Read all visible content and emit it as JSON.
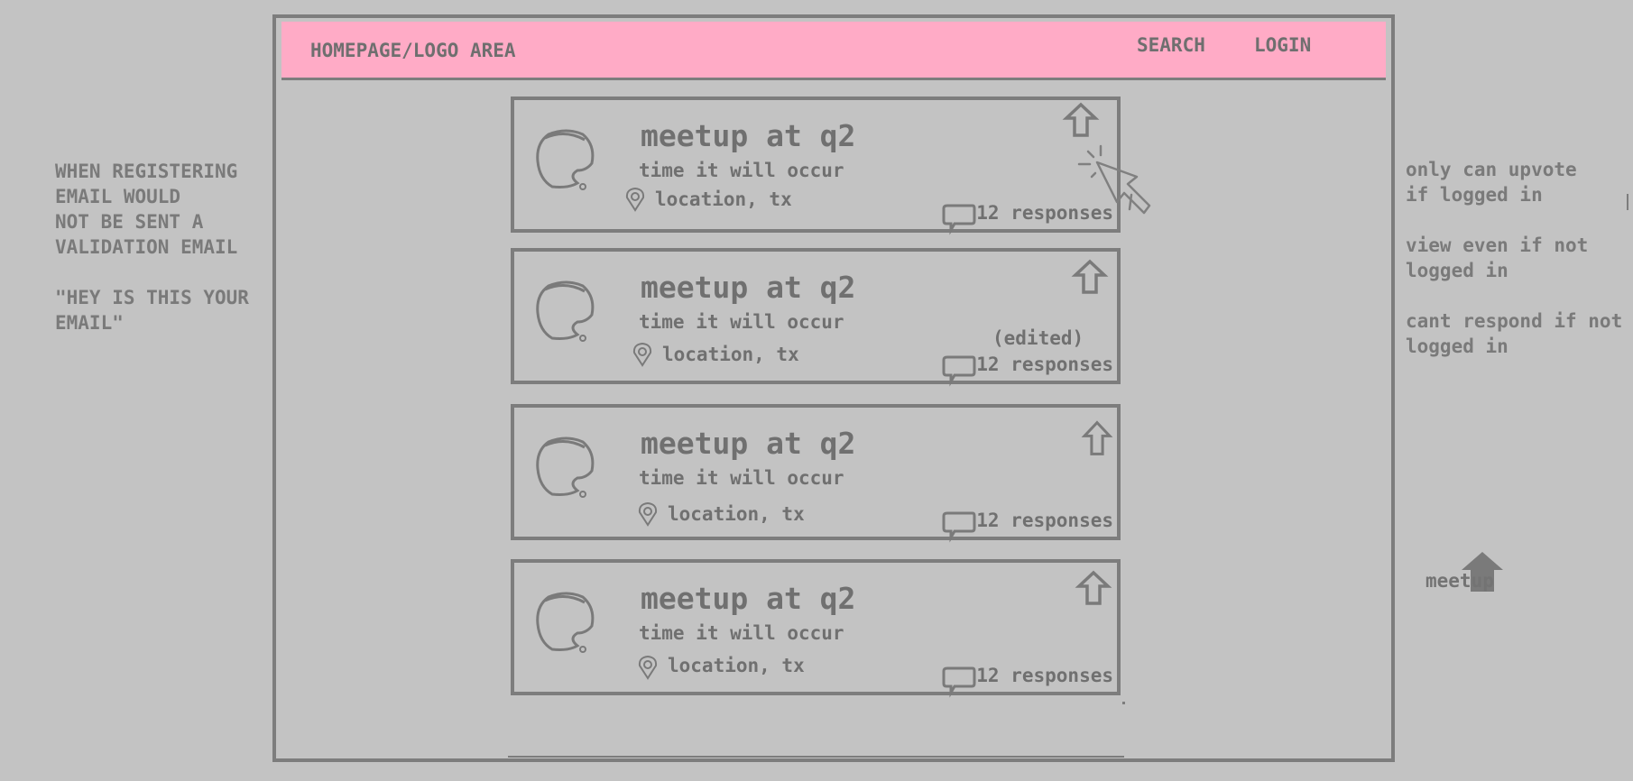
{
  "notes": {
    "left": "WHEN REGISTERING\nEMAIL WOULD\nNOT BE SENT A\nVALIDATION EMAIL\n\n\"HEY IS THIS YOUR\nEMAIL\"",
    "right": "only can upvote\nif logged in\n\nview even if not\nlogged in\n\ncant respond if not\nlogged in"
  },
  "header": {
    "logo_text": "HOMEPAGE/LOGO AREA",
    "search_label": "SEARCH",
    "login_label": "LOGIN"
  },
  "cards": [
    {
      "title": "meetup at q2",
      "time": "time it will occur",
      "location": "location, tx",
      "responses": "12 responses",
      "edited": ""
    },
    {
      "title": "meetup at q2",
      "time": "time it will occur",
      "location": "location, tx",
      "responses": "12 responses",
      "edited": "(edited)"
    },
    {
      "title": "meetup at q2",
      "time": "time it will occur",
      "location": "location, tx",
      "responses": "12 responses",
      "edited": ""
    },
    {
      "title": "meetup at q2",
      "time": "time it will occur",
      "location": "location, tx",
      "responses": "12 responses",
      "edited": ""
    }
  ],
  "meetup_logo": {
    "text": "meetup"
  },
  "icons": {
    "avatar": "avatar-icon",
    "upvote": "upvote-arrow-icon",
    "location": "location-pin-icon",
    "responses": "speech-bubble-icon",
    "cursor": "mouse-cursor-icon"
  },
  "colors": {
    "header_bg": "#ffabc6",
    "page_bg": "#c3c3c3",
    "ink": "#7d7d7d"
  }
}
